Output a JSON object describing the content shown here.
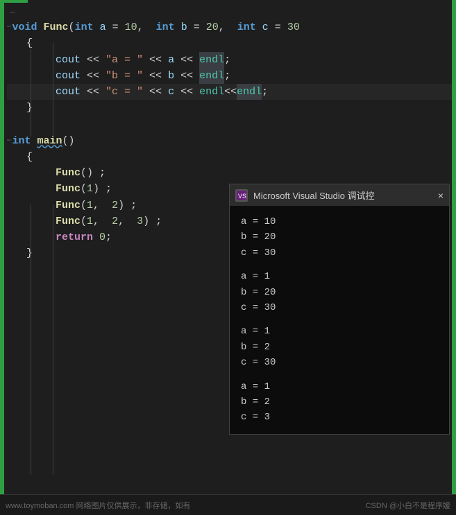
{
  "editor": {
    "lines": [
      {
        "id": "line-top-partial",
        "type": "partial"
      },
      {
        "id": "line-func-decl",
        "type": "code"
      },
      {
        "id": "line-open-brace",
        "type": "code"
      },
      {
        "id": "line-cout-a",
        "type": "code"
      },
      {
        "id": "line-cout-b",
        "type": "code"
      },
      {
        "id": "line-cout-c",
        "type": "code"
      },
      {
        "id": "line-close-brace",
        "type": "code"
      },
      {
        "id": "line-blank1",
        "type": "blank"
      },
      {
        "id": "line-main-decl",
        "type": "code"
      },
      {
        "id": "line-main-open",
        "type": "code"
      },
      {
        "id": "line-func1",
        "type": "code"
      },
      {
        "id": "line-func2",
        "type": "code"
      },
      {
        "id": "line-func3",
        "type": "code"
      },
      {
        "id": "line-func4",
        "type": "code"
      },
      {
        "id": "line-return",
        "type": "code"
      },
      {
        "id": "line-main-close",
        "type": "code"
      }
    ]
  },
  "console": {
    "title": "Microsoft Visual Studio 调试控",
    "icon": "VS",
    "close_label": "×",
    "output_groups": [
      {
        "lines": [
          "a = 10",
          "b = 20",
          "c = 30"
        ]
      },
      {
        "lines": [
          "a = 1",
          "b = 20",
          "c = 30"
        ]
      },
      {
        "lines": [
          "a = 1",
          "b = 2",
          "c = 30"
        ]
      },
      {
        "lines": [
          "a = 1",
          "b = 2",
          "c = 3"
        ]
      }
    ]
  },
  "watermark": {
    "left": "www.toymoban.com 网络图片仅供展示，非存储，如有",
    "right": "CSDN @小白不是程序媛"
  }
}
